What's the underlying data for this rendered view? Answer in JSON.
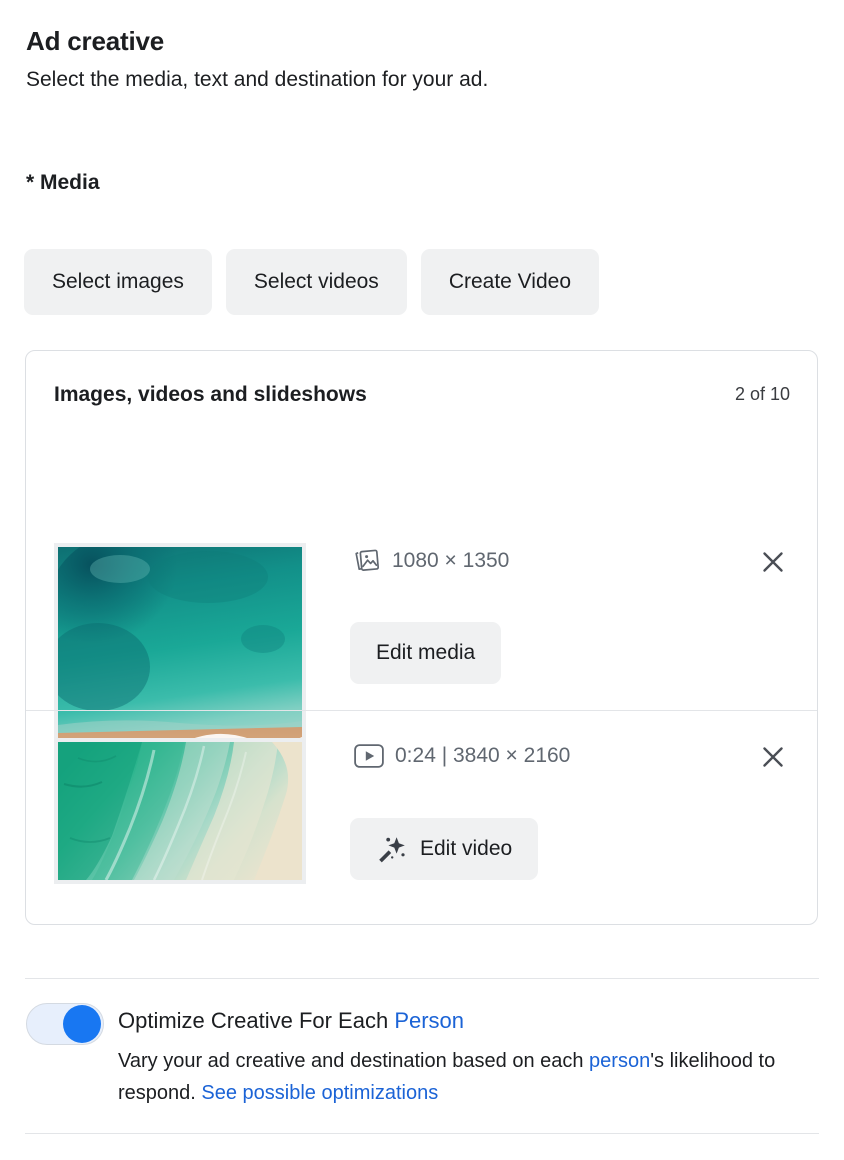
{
  "section": {
    "title": "Ad creative",
    "subtitle": "Select the media, text and destination for your ad.",
    "media_label": "* Media"
  },
  "media_buttons": [
    {
      "label": "Select images",
      "name": "select-images-button"
    },
    {
      "label": "Select videos",
      "name": "select-videos-button"
    },
    {
      "label": "Create Video",
      "name": "create-video-button"
    }
  ],
  "media_card": {
    "title": "Images, videos and slideshows",
    "count": "2 of 10",
    "items": [
      {
        "type": "image",
        "icon": "image-stack-icon",
        "meta": "1080 × 1350",
        "edit_label": "Edit media",
        "edit_icon": "none",
        "remove_icon": "close-icon"
      },
      {
        "type": "video",
        "icon": "play-icon",
        "meta": "0:24 | 3840 × 2160",
        "edit_label": "Edit video",
        "edit_icon": "magic-wand-icon",
        "remove_icon": "close-icon"
      }
    ]
  },
  "optimize": {
    "toggle_state": "on",
    "title_prefix": "Optimize Creative For Each ",
    "title_link": "Person",
    "desc_part1": "Vary your ad creative and destination based on each ",
    "desc_link1": "person",
    "desc_part2": "'s likelihood to respond. ",
    "desc_link2": "See possible optimizations"
  },
  "colors": {
    "accent_blue": "#1877f2",
    "link_blue": "#1b63d6",
    "button_gray": "#f0f1f2",
    "border_gray": "#dcdfe3",
    "text_dark": "#1c1e21",
    "text_muted": "#606770"
  }
}
